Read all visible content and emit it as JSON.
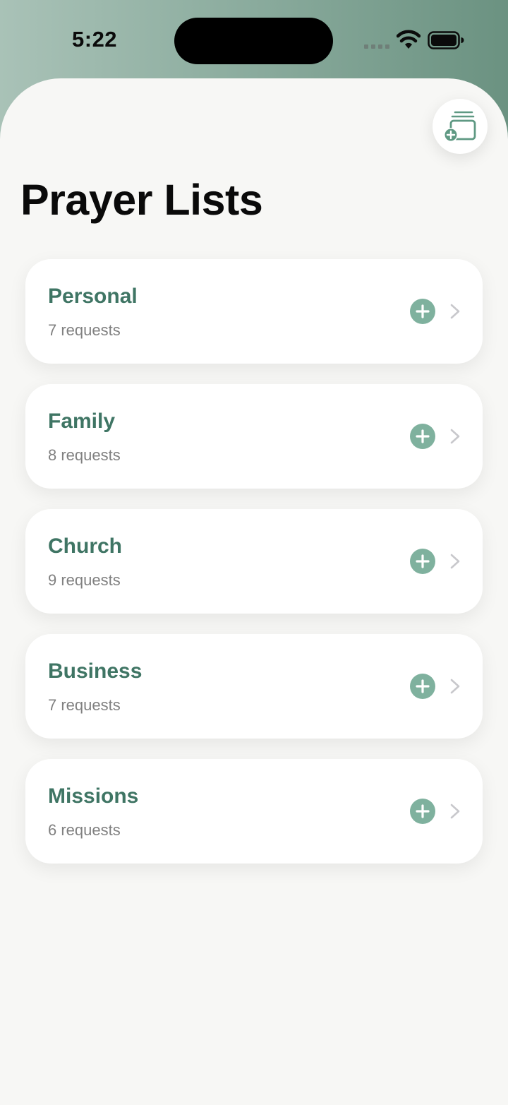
{
  "status_bar": {
    "time": "5:22"
  },
  "header": {
    "title": "Prayer Lists",
    "add_button_icon": "stack-plus-icon"
  },
  "lists": [
    {
      "name": "Personal",
      "count_label": "7 requests"
    },
    {
      "name": "Family",
      "count_label": "8 requests"
    },
    {
      "name": "Church",
      "count_label": "9 requests"
    },
    {
      "name": "Business",
      "count_label": "7 requests"
    },
    {
      "name": "Missions",
      "count_label": "6 requests"
    }
  ],
  "colors": {
    "accent": "#3f7564",
    "accent_light": "#7fb19e",
    "background": "#f7f7f5",
    "card": "#ffffff",
    "subtitle": "#808080"
  }
}
